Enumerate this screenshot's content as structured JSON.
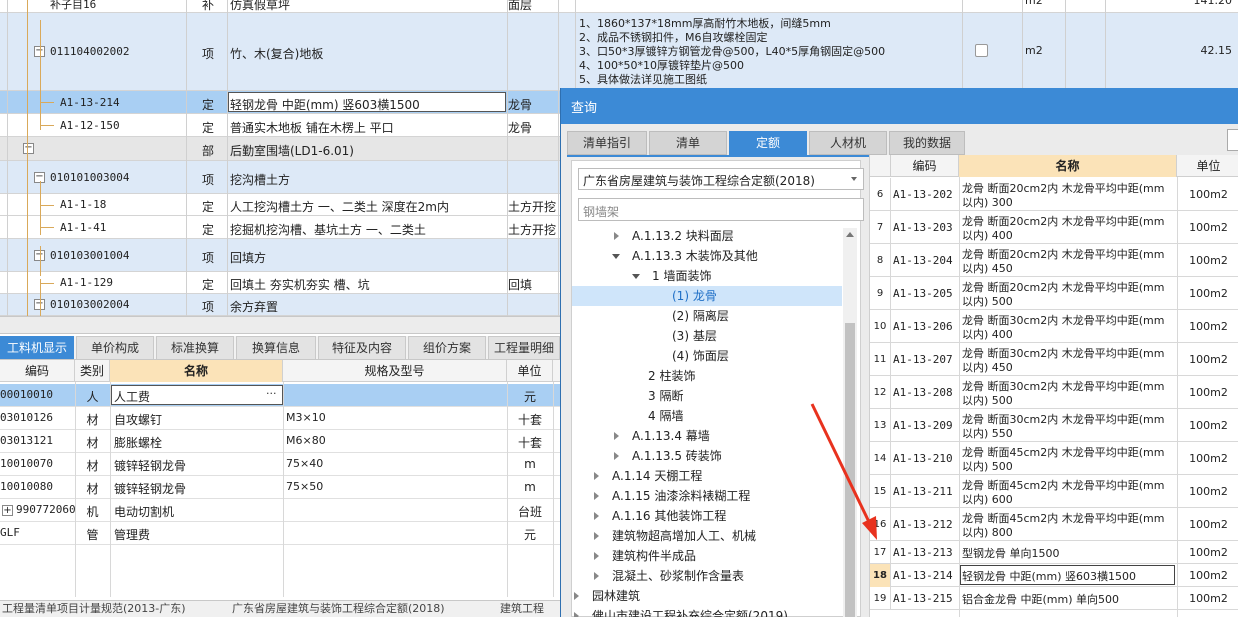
{
  "top_table": {
    "rows": [
      {
        "code": "补子目16",
        "cat": "补",
        "name": "仿真假草坪",
        "spec": "面层",
        "unit": "m2",
        "qty": "141.20"
      },
      {
        "code": "011104002002",
        "cat": "项",
        "name": "竹、木(复合)地板",
        "features": [
          "1、1860*137*18mm厚高耐竹木地板，间缝5mm",
          "2、成品不锈钢扣件，M6自攻螺栓固定",
          "3、口50*3厚镀锌方钢管龙骨@500，L40*5厚角钢固定@500",
          "4、100*50*10厚镀锌垫片@500",
          "5、具体做法详见施工图纸"
        ],
        "unit": "m2",
        "qty": "42.15"
      },
      {
        "code": "A1-13-214",
        "cat": "定",
        "name": "轻钢龙骨 中距(mm) 竖603横1500",
        "spec": "龙骨"
      },
      {
        "code": "A1-12-150",
        "cat": "定",
        "name": "普通实木地板 铺在木楞上 平口",
        "spec": "龙骨"
      },
      {
        "code": "",
        "cat": "部",
        "name": "后勤室围墙(LD1-6.01)",
        "spec": ""
      },
      {
        "code": "010101003004",
        "cat": "项",
        "name": "挖沟槽土方",
        "spec": ""
      },
      {
        "code": "A1-1-18",
        "cat": "定",
        "name": "人工挖沟槽土方 一、二类土 深度在2m内",
        "spec": "土方开挖"
      },
      {
        "code": "A1-1-41",
        "cat": "定",
        "name": "挖掘机挖沟槽、基坑土方 一、二类土",
        "spec": "土方开挖"
      },
      {
        "code": "010103001004",
        "cat": "项",
        "name": "回填方",
        "spec": ""
      },
      {
        "code": "A1-1-129",
        "cat": "定",
        "name": "回填土 夯实机夯实 槽、坑",
        "spec": "回填"
      },
      {
        "code": "010103002004",
        "cat": "项",
        "name": "余方弃置",
        "spec": ""
      }
    ]
  },
  "bottom_panel": {
    "tabs": [
      "工料机显示",
      "单价构成",
      "标准换算",
      "换算信息",
      "特征及内容",
      "组价方案",
      "工程量明细"
    ],
    "headers": {
      "code": "编码",
      "cat": "类别",
      "name": "名称",
      "spec": "规格及型号",
      "unit": "单位"
    },
    "rows": [
      {
        "code": "00010010",
        "cat": "人",
        "name": "人工费",
        "spec": "",
        "unit": "元",
        "ellipsis": "···"
      },
      {
        "code": "03010126",
        "cat": "材",
        "name": "自攻螺钉",
        "spec": "M3×10",
        "unit": "十套"
      },
      {
        "code": "03013121",
        "cat": "材",
        "name": "膨胀螺栓",
        "spec": "M6×80",
        "unit": "十套"
      },
      {
        "code": "10010070",
        "cat": "材",
        "name": "镀锌轻钢龙骨",
        "spec": "75×40",
        "unit": "m"
      },
      {
        "code": "10010080",
        "cat": "材",
        "name": "镀锌轻钢龙骨",
        "spec": "75×50",
        "unit": "m"
      },
      {
        "code": "990772060",
        "cat": "机",
        "name": "电动切割机",
        "spec": "",
        "unit": "台班",
        "expand": "+"
      },
      {
        "code": "GLF",
        "cat": "管",
        "name": "管理费",
        "spec": "",
        "unit": "元"
      }
    ],
    "status_left": "工程量清单项目计量规范(2013-广东)",
    "status_right": "广东省房屋建筑与装饰工程综合定额(2018)",
    "status_far": "建筑工程"
  },
  "query_dialog": {
    "title": "查询",
    "tabs": [
      "清单指引",
      "清单",
      "定额",
      "人材机",
      "我的数据"
    ],
    "active_tab": "定额",
    "dropdown_value": "广东省房屋建筑与装饰工程综合定额(2018)",
    "search_placeholder": "钢墙架",
    "tree": [
      {
        "label": "A.1.13.2 块料面层",
        "level": 2,
        "state": "collapsed"
      },
      {
        "label": "A.1.13.3 木装饰及其他",
        "level": 2,
        "state": "expanded"
      },
      {
        "label": "1 墙面装饰",
        "level": 3,
        "state": "expanded"
      },
      {
        "label": "(1) 龙骨",
        "level": 4,
        "state": "leaf",
        "selected": true
      },
      {
        "label": "(2) 隔离层",
        "level": 4,
        "state": "leaf"
      },
      {
        "label": "(3) 基层",
        "level": 4,
        "state": "leaf"
      },
      {
        "label": "(4) 饰面层",
        "level": 4,
        "state": "leaf"
      },
      {
        "label": "2 柱装饰",
        "level": 3,
        "state": "leaf"
      },
      {
        "label": "3 隔断",
        "level": 3,
        "state": "leaf"
      },
      {
        "label": "4 隔墙",
        "level": 3,
        "state": "leaf"
      },
      {
        "label": "A.1.13.4 幕墙",
        "level": 2,
        "state": "collapsed"
      },
      {
        "label": "A.1.13.5 砖装饰",
        "level": 2,
        "state": "collapsed"
      },
      {
        "label": "A.1.14 天棚工程",
        "level": 1,
        "state": "collapsed"
      },
      {
        "label": "A.1.15 油漆涂料裱糊工程",
        "level": 1,
        "state": "collapsed"
      },
      {
        "label": "A.1.16 其他装饰工程",
        "level": 1,
        "state": "collapsed"
      },
      {
        "label": "建筑物超高增加人工、机械",
        "level": 1,
        "state": "collapsed"
      },
      {
        "label": "建筑构件半成品",
        "level": 1,
        "state": "collapsed"
      },
      {
        "label": "混凝土、砂浆制作含量表",
        "level": 1,
        "state": "collapsed"
      },
      {
        "label": "园林建筑",
        "level": 0,
        "state": "collapsed"
      },
      {
        "label": "佛山市建设工程补充综合定额(2019)",
        "level": 0,
        "state": "collapsed"
      }
    ],
    "headers": {
      "code": "编码",
      "name": "名称",
      "unit": "单位"
    },
    "rows": [
      {
        "no": "6",
        "code": "A1-13-202",
        "name": [
          "龙骨 断面20cm2内 木龙骨平均中距(mm",
          "以内) 300"
        ],
        "unit": "100m2"
      },
      {
        "no": "7",
        "code": "A1-13-203",
        "name": [
          "龙骨 断面20cm2内 木龙骨平均中距(mm",
          "以内) 400"
        ],
        "unit": "100m2"
      },
      {
        "no": "8",
        "code": "A1-13-204",
        "name": [
          "龙骨 断面20cm2内 木龙骨平均中距(mm",
          "以内) 450"
        ],
        "unit": "100m2"
      },
      {
        "no": "9",
        "code": "A1-13-205",
        "name": [
          "龙骨 断面20cm2内 木龙骨平均中距(mm",
          "以内) 500"
        ],
        "unit": "100m2"
      },
      {
        "no": "10",
        "code": "A1-13-206",
        "name": [
          "龙骨 断面30cm2内 木龙骨平均中距(mm",
          "以内) 400"
        ],
        "unit": "100m2"
      },
      {
        "no": "11",
        "code": "A1-13-207",
        "name": [
          "龙骨 断面30cm2内 木龙骨平均中距(mm",
          "以内) 450"
        ],
        "unit": "100m2"
      },
      {
        "no": "12",
        "code": "A1-13-208",
        "name": [
          "龙骨 断面30cm2内 木龙骨平均中距(mm",
          "以内) 500"
        ],
        "unit": "100m2"
      },
      {
        "no": "13",
        "code": "A1-13-209",
        "name": [
          "龙骨 断面30cm2内 木龙骨平均中距(mm",
          "以内) 550"
        ],
        "unit": "100m2"
      },
      {
        "no": "14",
        "code": "A1-13-210",
        "name": [
          "龙骨 断面45cm2内 木龙骨平均中距(mm",
          "以内) 500"
        ],
        "unit": "100m2"
      },
      {
        "no": "15",
        "code": "A1-13-211",
        "name": [
          "龙骨 断面45cm2内 木龙骨平均中距(mm",
          "以内) 600"
        ],
        "unit": "100m2"
      },
      {
        "no": "16",
        "code": "A1-13-212",
        "name": [
          "龙骨 断面45cm2内 木龙骨平均中距(mm",
          "以内) 800"
        ],
        "unit": "100m2"
      },
      {
        "no": "17",
        "code": "A1-13-213",
        "name": [
          "型钢龙骨 单向1500"
        ],
        "unit": "100m2"
      },
      {
        "no": "18",
        "code": "A1-13-214",
        "name": [
          "轻钢龙骨 中距(mm) 竖603横1500"
        ],
        "unit": "100m2",
        "selected": true
      },
      {
        "no": "19",
        "code": "A1-13-215",
        "name": [
          "铝合金龙骨 中距(mm) 单向500"
        ],
        "unit": "100m2"
      }
    ]
  },
  "colors": {
    "accent": "#3c8ad6",
    "selected_row": "#a9cff3",
    "header_bg": "#fbe3b8",
    "item_row": "#dde9f7",
    "part_row": "#e6e6e6",
    "arrow": "#e8321e"
  }
}
